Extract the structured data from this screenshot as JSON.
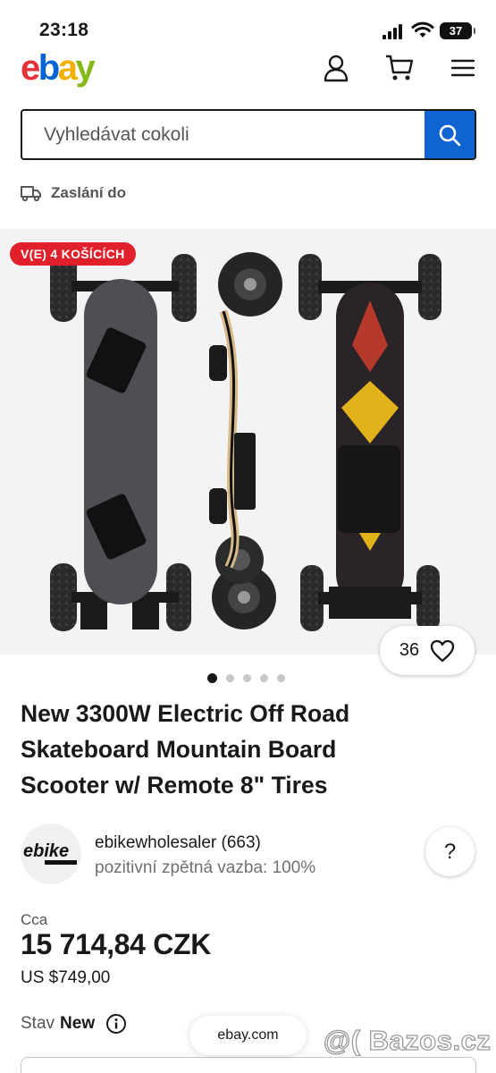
{
  "status_bar": {
    "time": "23:18",
    "battery": "37"
  },
  "header": {
    "logo": {
      "e": "e",
      "b": "b",
      "a": "a",
      "y": "y"
    },
    "icons": [
      "user-icon",
      "cart-icon",
      "menu-icon"
    ]
  },
  "search": {
    "placeholder": "Vyhledávat cokoli",
    "button_icon": "search-icon"
  },
  "shipping": {
    "label": "Zaslání do",
    "icon": "truck-icon"
  },
  "gallery": {
    "badge": "V(E) 4 KOŠÍCÍCH",
    "watch_count": "36",
    "image_count": 5,
    "active_index": 0
  },
  "listing": {
    "title": "New 3300W Electric Off Road Skateboard Mountain Board Scooter w/ Remote 8\" Tires"
  },
  "seller": {
    "name": "ebikewholesaler (663)",
    "feedback": "pozitivní zpětná vazba: 100%",
    "avatar_text": "ebike",
    "help": "?"
  },
  "price": {
    "label": "Cca",
    "value": "15 714,84 CZK",
    "usd": "US $749,00"
  },
  "condition": {
    "label": "Stav",
    "value": "New"
  },
  "browser": {
    "domain": "ebay.com"
  },
  "watermark": "@( Bazos.cz",
  "colors": {
    "ebay_red": "#e53238",
    "ebay_blue": "#0064d2",
    "ebay_yellow": "#f5af02",
    "ebay_green": "#86b817",
    "search_button": "#0f64d2",
    "badge_red": "#e0212b"
  }
}
